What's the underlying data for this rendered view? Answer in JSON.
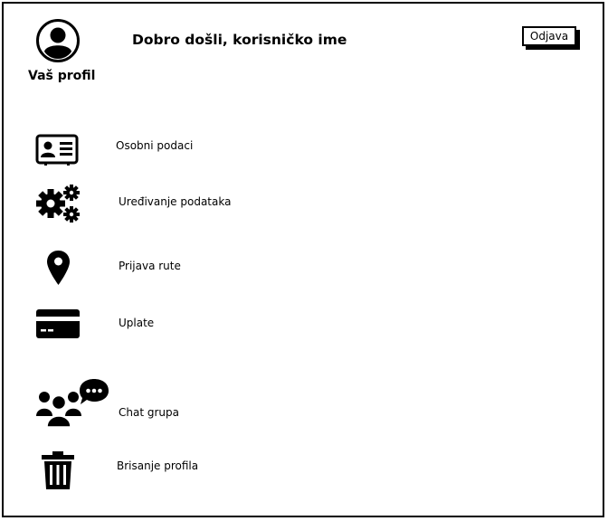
{
  "header": {
    "welcome_text": "Dobro došli, korisničko ime",
    "profile_label": "Vaš profil",
    "logout_label": "Odjava"
  },
  "menu": {
    "items": [
      {
        "label": "Osobni podaci",
        "icon": "id-card-icon"
      },
      {
        "label": "Uređivanje podataka",
        "icon": "gears-icon"
      },
      {
        "label": "Prijava rute",
        "icon": "map-pin-icon"
      },
      {
        "label": "Uplate",
        "icon": "credit-card-icon"
      },
      {
        "label": "Chat grupa",
        "icon": "group-chat-icon"
      },
      {
        "label": "Brisanje profila",
        "icon": "trash-icon"
      }
    ]
  }
}
